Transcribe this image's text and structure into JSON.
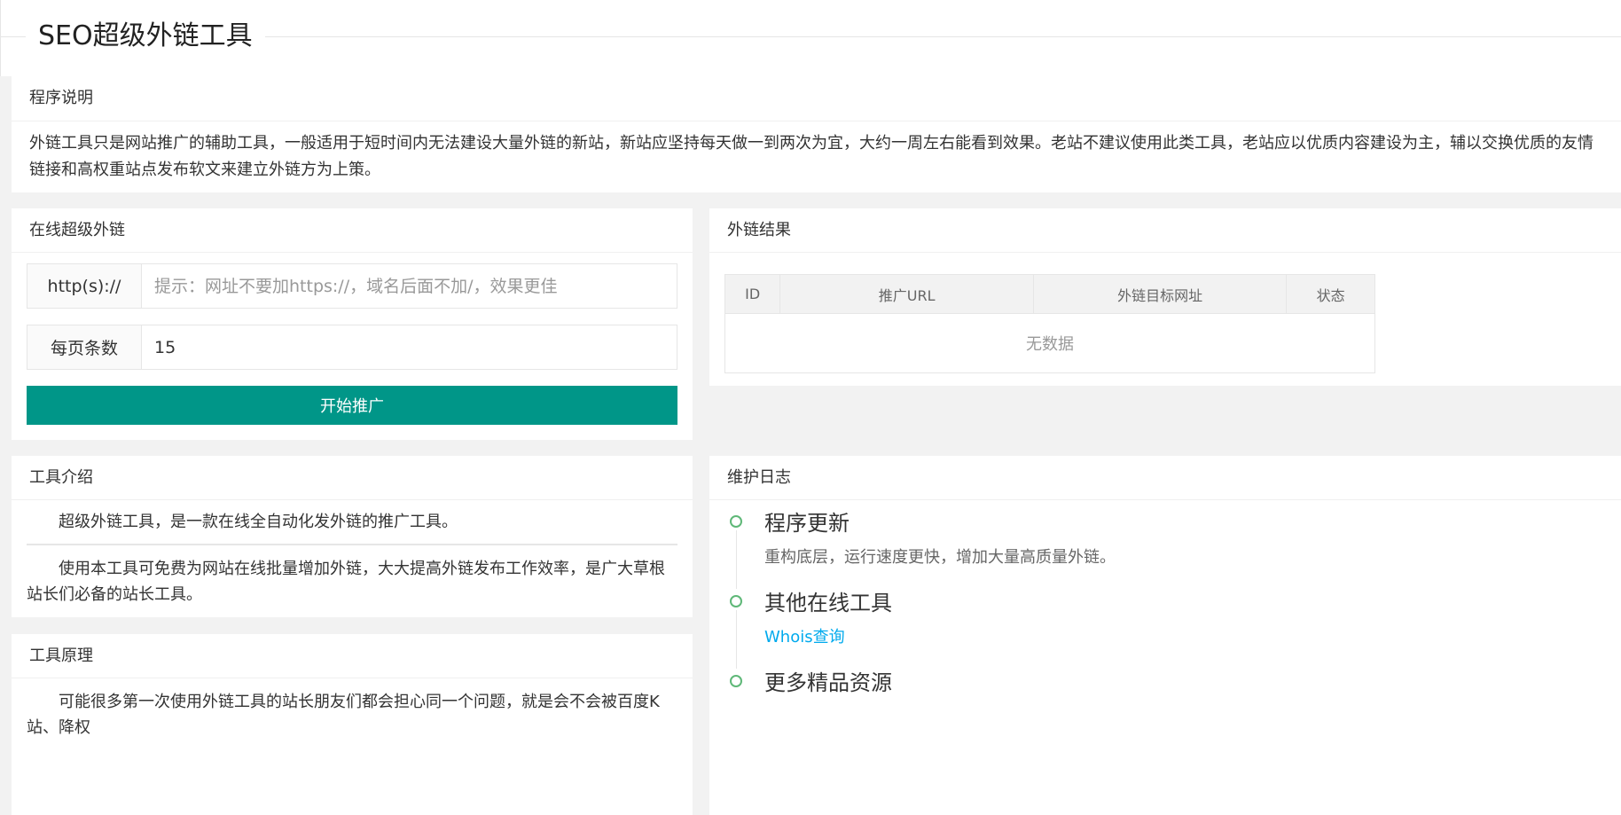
{
  "header": {
    "title": "SEO超级外链工具"
  },
  "description": {
    "title": "程序说明",
    "text": "外链工具只是网站推广的辅助工具，一般适用于短时间内无法建设大量外链的新站，新站应坚持每天做一到两次为宜，大约一周左右能看到效果。老站不建议使用此类工具，老站应以优质内容建设为主，辅以交换优质的友情链接和高权重站点发布软文来建立外链方为上策。"
  },
  "form": {
    "title": "在线超级外链",
    "url_label": "http(s)://",
    "url_placeholder": "提示：网址不要加https://，域名后面不加/，效果更佳",
    "per_page_label": "每页条数",
    "per_page_value": "15",
    "submit_label": "开始推广"
  },
  "result": {
    "title": "外链结果",
    "columns": [
      "ID",
      "推广URL",
      "外链目标网址",
      "状态"
    ],
    "empty_text": "无数据"
  },
  "intro": {
    "title": "工具介绍",
    "para1": "超级外链工具，是一款在线全自动化发外链的推广工具。",
    "para2": "使用本工具可免费为网站在线批量增加外链，大大提高外链发布工作效率，是广大草根站长们必备的站长工具。"
  },
  "principle": {
    "title": "工具原理",
    "text": "可能很多第一次使用外链工具的站长朋友们都会担心同一个问题，就是会不会被百度K站、降权"
  },
  "log": {
    "title": "维护日志",
    "items": [
      {
        "title": "程序更新",
        "content": "重构底层，运行速度更快，增加大量高质量外链。"
      },
      {
        "title": "其他在线工具",
        "link": "Whois查询"
      },
      {
        "title": "更多精品资源"
      }
    ]
  },
  "colors": {
    "primary": "#009688",
    "timeline_dot": "#5fb878",
    "link": "#01aaed"
  }
}
